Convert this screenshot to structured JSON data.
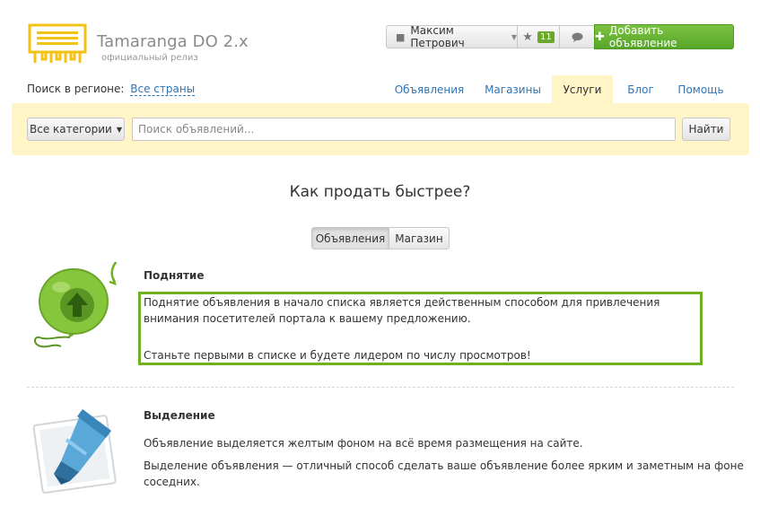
{
  "brand": {
    "name": "Tamaranga DO 2.x",
    "subtitle": "официальный релиз"
  },
  "header": {
    "user_name": "Максим Петрович",
    "favorites_count": "11",
    "add_button_label": "Добавить объявление"
  },
  "region": {
    "label": "Поиск в регионе:",
    "value": "Все страны"
  },
  "nav": {
    "items": [
      {
        "label": "Объявления"
      },
      {
        "label": "Магазины"
      },
      {
        "label": "Услуги"
      },
      {
        "label": "Блог"
      },
      {
        "label": "Помощь"
      }
    ],
    "active": "Услуги"
  },
  "search": {
    "category_label": "Все категории",
    "placeholder": "Поиск объявлений...",
    "button_label": "Найти"
  },
  "page": {
    "title": "Как продать быстрее?",
    "tabs": [
      {
        "label": "Объявления"
      },
      {
        "label": "Магазин"
      }
    ],
    "active_tab": "Объявления"
  },
  "services": [
    {
      "title": "Поднятие",
      "paragraphs": [
        "Поднятие объявления в начало списка является действенным способом для привлечения внимания посетителей портала к вашему предложению.",
        "Станьте первыми в списке и будете лидером по числу просмотров!"
      ]
    },
    {
      "title": "Выделение",
      "paragraphs": [
        "Объявление выделяется желтым фоном на всё время размещения на сайте.",
        "Выделение объявления — отличный способ сделать ваше объявление более ярким и заметным на фоне соседних."
      ]
    }
  ],
  "colors": {
    "accent_green": "#6fb121",
    "link_blue": "#2b76b9",
    "search_bg": "#fff5c7",
    "logo_yellow": "#f2c315"
  }
}
